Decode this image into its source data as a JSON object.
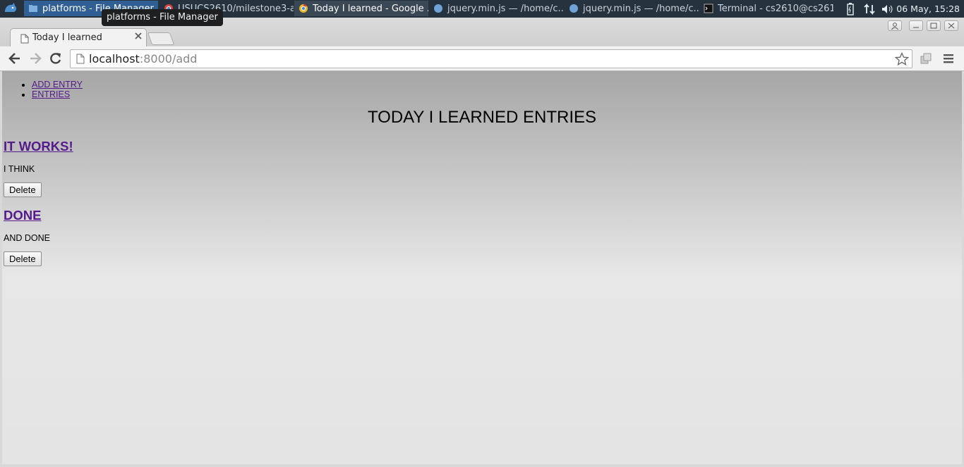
{
  "taskbar": {
    "tasks": [
      {
        "label": "platforms - File Manager"
      },
      {
        "label": "USUCS2610/milestone3-a..."
      },
      {
        "label": "Today I learned - Google ..."
      },
      {
        "label": "jquery.min.js — /home/c..."
      },
      {
        "label": "jquery.min.js — /home/c..."
      },
      {
        "label": "Terminal - cs2610@cs261..."
      }
    ],
    "clock": "06 May, 15:28",
    "tooltip": "platforms - File Manager"
  },
  "browser": {
    "tab_title": "Today I learned",
    "url_host": "localhost",
    "url_rest": ":8000/add"
  },
  "page": {
    "nav": [
      "ADD ENTRY",
      "ENTRIES"
    ],
    "heading": "TODAY I LEARNED ENTRIES",
    "entries": [
      {
        "title": "IT WORKS!",
        "body": "I THINK",
        "button": "Delete"
      },
      {
        "title": "DONE",
        "body": "AND DONE",
        "button": "Delete"
      }
    ]
  },
  "colors": {
    "taskbar_bg": "#26333f",
    "active_task": "#2f5f93",
    "link_visited": "#551a8b"
  }
}
